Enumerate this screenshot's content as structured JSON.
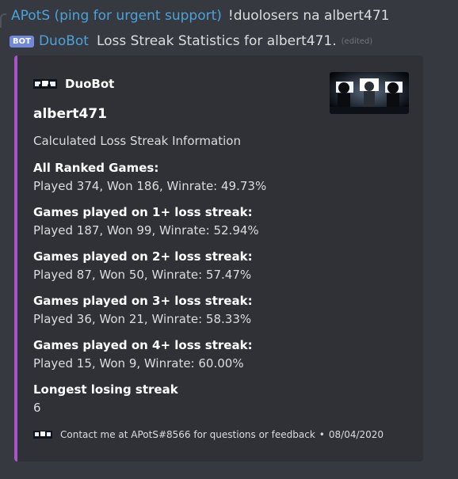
{
  "reply": {
    "author": "APotS (ping for urgent support)",
    "text": "!duolosers na albert471"
  },
  "message": {
    "bot_tag": "BOT",
    "author": "DuoBot",
    "content": "Loss Streak Statistics for albert471.",
    "edited_label": "(edited)"
  },
  "embed": {
    "accent_color": "#a855c8",
    "author_name": "DuoBot",
    "title": "albert471",
    "description": "Calculated Loss Streak Information",
    "fields": [
      {
        "name": "All Ranked Games:",
        "value": "Played 374, Won 186, Winrate: 49.73%"
      },
      {
        "name": "Games played on 1+ loss streak:",
        "value": "Played 187, Won 99, Winrate: 52.94%"
      },
      {
        "name": "Games played on 2+ loss streak:",
        "value": "Played 87, Won 50, Winrate: 57.47%"
      },
      {
        "name": "Games played on 3+ loss streak:",
        "value": "Played 36, Won 21, Winrate: 58.33%"
      },
      {
        "name": "Games played on 4+ loss streak:",
        "value": "Played 15, Won 9, Winrate: 60.00%"
      },
      {
        "name": "Longest losing streak",
        "value": "6"
      }
    ],
    "footer_text": "Contact me at APotS#8566 for questions or feedback",
    "footer_separator": "•",
    "footer_date": "08/04/2020"
  }
}
